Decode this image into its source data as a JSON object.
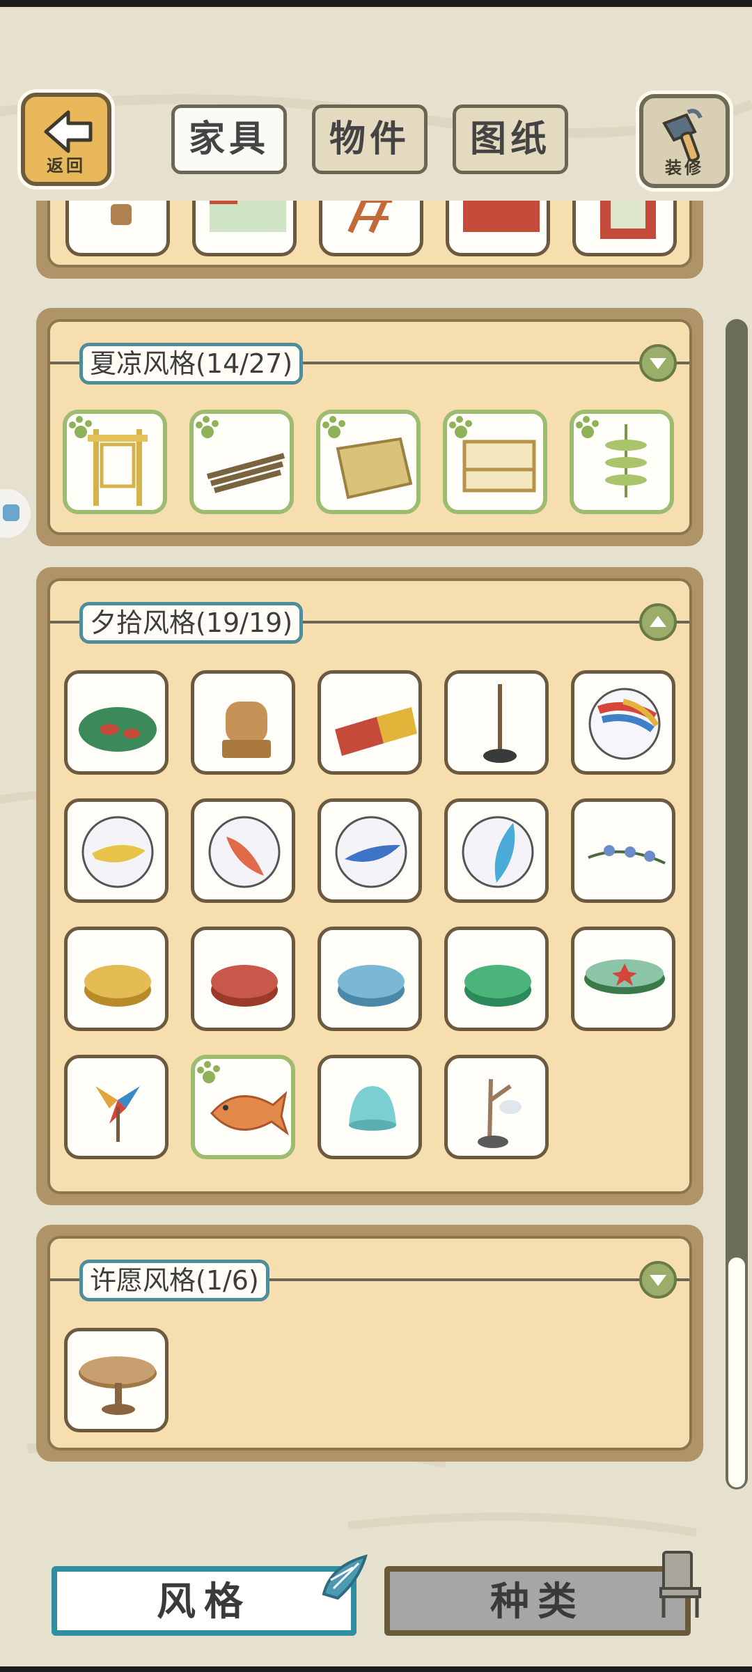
{
  "header": {
    "back_label": "返回",
    "tabs": [
      {
        "label": "家具",
        "active": true
      },
      {
        "label": "物件",
        "active": false
      },
      {
        "label": "图纸",
        "active": false
      }
    ],
    "decorate_label": "装修"
  },
  "sections": [
    {
      "title": "夏凉风格(14/27)",
      "expanded": false
    },
    {
      "title": "夕拾风格(19/19)",
      "expanded": true
    },
    {
      "title": "许愿风格(1/6)",
      "expanded": false
    }
  ],
  "section2_items": [
    "frog-stone",
    "wooden-frog-statue",
    "red-yellow-rug",
    "stick-stand",
    "tricolor-marble",
    "yellow-marble",
    "red-marble",
    "blue-marble",
    "cyan-marble",
    "flower-sprig",
    "yellow-checker",
    "red-checker",
    "blue-checker",
    "green-checker",
    "starfish-table",
    "pinwheel",
    "fish-cake",
    "jelly",
    "shell-branch"
  ],
  "bottom_tabs": {
    "style_label": "风格",
    "kind_label": "种类"
  },
  "colors": {
    "accent_teal": "#2f8fa0",
    "panel_inner": "#f6deaf",
    "new_border": "#9dbc70"
  }
}
